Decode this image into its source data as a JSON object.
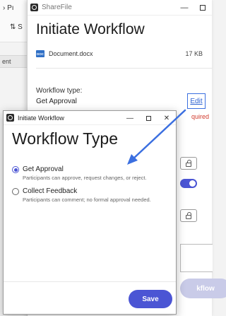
{
  "background_app": {
    "toolbar_item_1": "S",
    "toolbar_item_2": "Pı",
    "sidebar_row": "ent"
  },
  "sharefile_window": {
    "title": "ShareFile",
    "heading": "Initiate Workflow",
    "document": {
      "icon_text": "DOC",
      "name": "Document.docx",
      "size": "17 KB"
    },
    "workflow_type_label": "Workflow type:",
    "workflow_type_value": "Get Approval",
    "edit_link": "Edit",
    "required_text": "quired",
    "primary_button_label": "kflow"
  },
  "dialog": {
    "title": "Initiate Workflow",
    "heading": "Workflow Type",
    "options": [
      {
        "label": "Get Approval",
        "description": "Participants can approve, request changes, or reject.",
        "checked": true
      },
      {
        "label": "Collect Feedback",
        "description": "Participants can comment; no formal approval needed.",
        "checked": false
      }
    ],
    "save_label": "Save"
  },
  "colors": {
    "accent": "#4b55d4",
    "highlight": "#3b6fe0",
    "required": "#d23b2e"
  }
}
